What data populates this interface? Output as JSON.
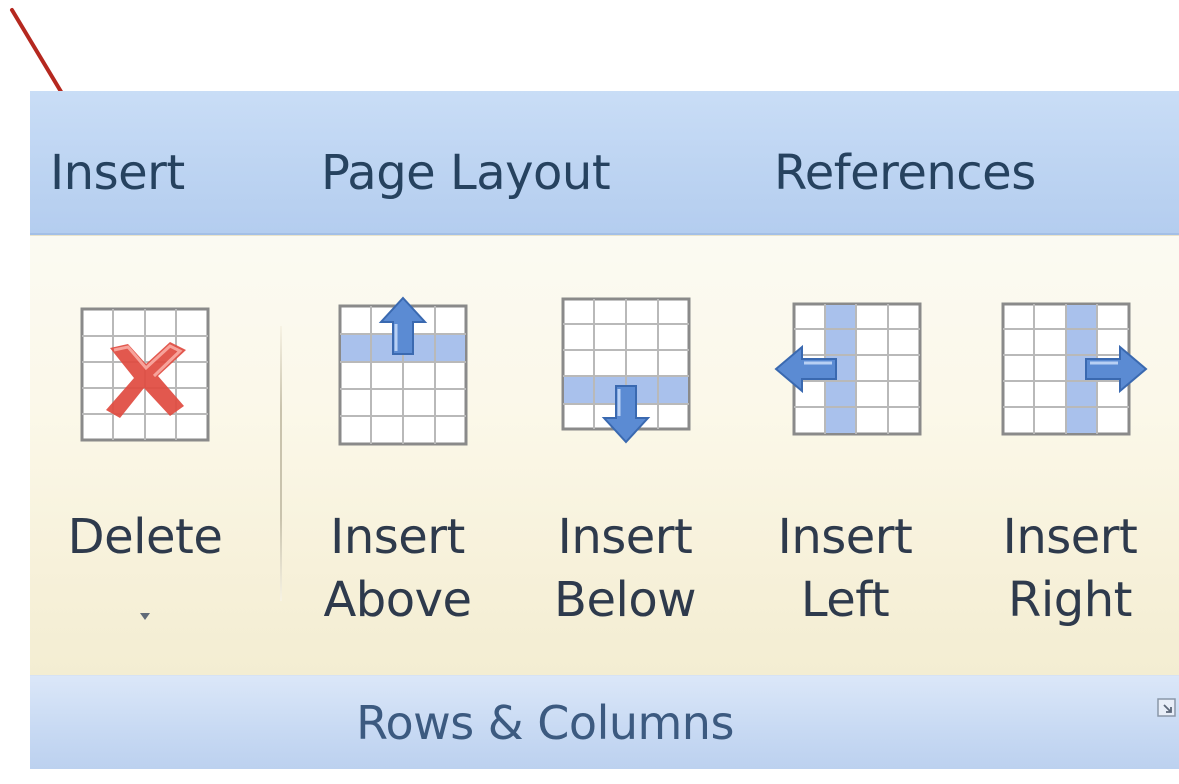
{
  "tabs": [
    {
      "label": "Insert"
    },
    {
      "label": "Page Layout"
    },
    {
      "label": "References"
    }
  ],
  "commands": {
    "delete": {
      "line1": "Delete",
      "icon": "delete-table-icon"
    },
    "insert_above": {
      "line1": "Insert",
      "line2": "Above",
      "icon": "insert-rows-above-icon"
    },
    "insert_below": {
      "line1": "Insert",
      "line2": "Below",
      "icon": "insert-rows-below-icon"
    },
    "insert_left": {
      "line1": "Insert",
      "line2": "Left",
      "icon": "insert-columns-left-icon"
    },
    "insert_right": {
      "line1": "Insert",
      "line2": "Right",
      "icon": "insert-columns-right-icon"
    }
  },
  "group": {
    "label": "Rows & Columns",
    "launcher_icon": "dialog-launcher-icon"
  },
  "colors": {
    "annotation_arrow": "#b5281f",
    "tab_bar": "#bdd4f2",
    "ribbon": "#fbf8e9",
    "group_bar": "#c7d9f3",
    "highlight_cells": "#a9c1ec",
    "delete_x": "#e04a3f"
  }
}
